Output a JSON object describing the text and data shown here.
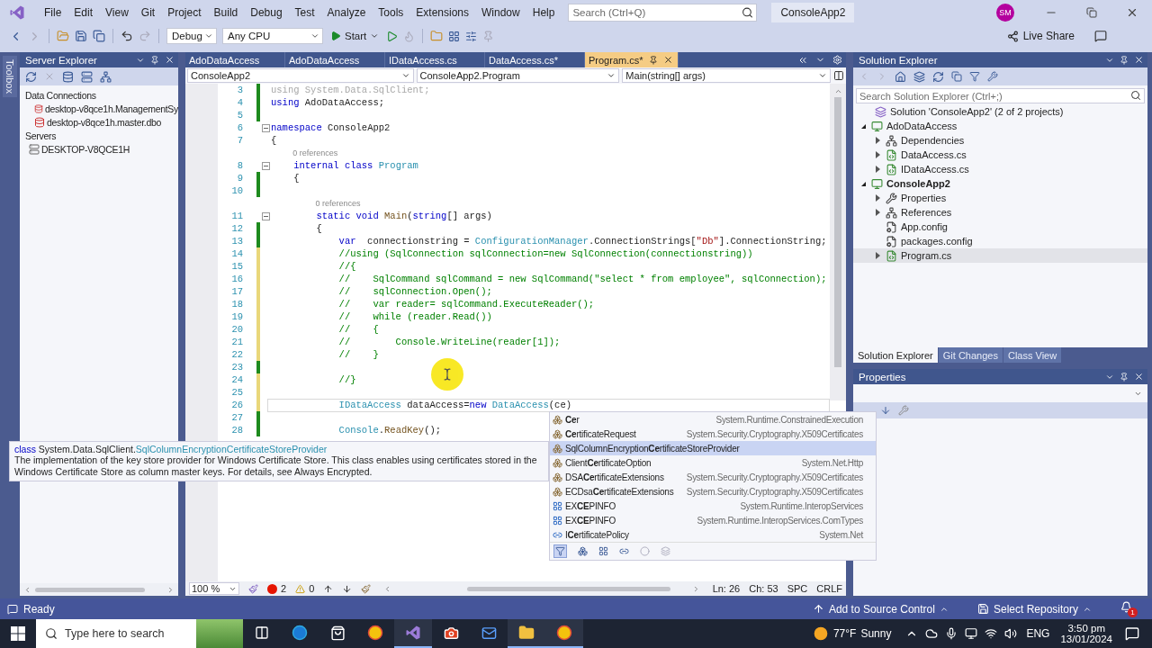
{
  "title_bar": {
    "menu": [
      "File",
      "Edit",
      "View",
      "Git",
      "Project",
      "Build",
      "Debug",
      "Test",
      "Analyze",
      "Tools",
      "Extensions",
      "Window",
      "Help"
    ],
    "search": {
      "placeholder": "Search (Ctrl+Q)"
    },
    "solution_name": "ConsoleApp2",
    "avatar": "SM"
  },
  "toolbar": {
    "configuration": "Debug",
    "platform": "Any CPU",
    "start": "Start",
    "live_share": "Live Share"
  },
  "toolbox_tab": "Toolbox",
  "server_explorer": {
    "title": "Server Explorer",
    "tree": [
      {
        "label": "Data Connections",
        "children": [
          {
            "label": "desktop-v8qce1h.ManagementSy",
            "kind": "connection"
          },
          {
            "label": "desktop-v8qce1h.master.dbo",
            "kind": "connection"
          }
        ]
      },
      {
        "label": "Servers",
        "children": [
          {
            "label": "DESKTOP-V8QCE1H",
            "kind": "server"
          }
        ]
      }
    ]
  },
  "editor": {
    "tabs": [
      {
        "label": "AdoDataAccess",
        "selected": false
      },
      {
        "label": "AdoDataAccess",
        "selected": false
      },
      {
        "label": "IDataAccess.cs",
        "selected": false
      },
      {
        "label": "DataAccess.cs*",
        "selected": false
      },
      {
        "label": "Program.cs*",
        "selected": true
      }
    ],
    "navigation": [
      "ConsoleApp2",
      "ConsoleApp2.Program",
      "Main(string[] args)"
    ],
    "lines": [
      {
        "kind": "code",
        "number": "3",
        "change_bar": {
          "saved": true
        },
        "fold": false,
        "current": false,
        "tokens": [
          {
            "kind": "faded",
            "text": "using System.Data.SqlClient;"
          }
        ]
      },
      {
        "kind": "code",
        "number": "4",
        "change_bar": {
          "saved": true
        },
        "fold": false,
        "current": false,
        "tokens": [
          {
            "kind": "keyword",
            "text": "using"
          },
          {
            "kind": "plain",
            "text": " AdoDataAccess;"
          }
        ]
      },
      {
        "kind": "code",
        "number": "5",
        "change_bar": {
          "saved": true
        },
        "fold": false,
        "current": false
      },
      {
        "kind": "code",
        "number": "6",
        "fold": true,
        "current": false,
        "tokens": [
          {
            "kind": "keyword",
            "text": "namespace"
          },
          {
            "kind": "plain",
            "text": " ConsoleApp2"
          }
        ]
      },
      {
        "kind": "code",
        "number": "7",
        "fold": false,
        "current": false,
        "tokens": [
          {
            "kind": "plain",
            "text": "{"
          }
        ]
      },
      {
        "kind": "codelens",
        "text": "0 references"
      },
      {
        "kind": "code",
        "number": "8",
        "fold": true,
        "current": false,
        "tokens": [
          {
            "kind": "keyword",
            "text": "    internal class"
          },
          {
            "kind": "type",
            "text": " Program"
          }
        ]
      },
      {
        "kind": "code",
        "number": "9",
        "change_bar": {
          "saved": true
        },
        "fold": false,
        "current": false,
        "tokens": [
          {
            "kind": "plain",
            "text": "    {"
          }
        ]
      },
      {
        "kind": "code",
        "number": "10",
        "change_bar": {
          "saved": true
        },
        "fold": false,
        "current": false
      },
      {
        "kind": "codelens",
        "text": "0 references"
      },
      {
        "kind": "code",
        "number": "11",
        "fold": true,
        "current": false,
        "tokens": [
          {
            "kind": "keyword",
            "text": "        static void"
          },
          {
            "kind": "method",
            "text": " Main"
          },
          {
            "kind": "plain",
            "text": "("
          },
          {
            "kind": "keyword",
            "text": "string"
          },
          {
            "kind": "plain",
            "text": "[] args)"
          }
        ]
      },
      {
        "kind": "code",
        "number": "12",
        "change_bar": {
          "saved": true
        },
        "fold": false,
        "current": false,
        "tokens": [
          {
            "kind": "plain",
            "text": "        {"
          }
        ]
      },
      {
        "kind": "code",
        "number": "13",
        "change_bar": {
          "saved": true
        },
        "fold": false,
        "current": false,
        "tokens": [
          {
            "kind": "keyword",
            "text": "            var"
          },
          {
            "kind": "plain",
            "text": "  connectionstring ="
          },
          {
            "kind": "type",
            "text": " ConfigurationManager"
          },
          {
            "kind": "plain",
            "text": ".ConnectionStrings["
          },
          {
            "kind": "string",
            "text": "\"Db\""
          },
          {
            "kind": "plain",
            "text": "].ConnectionString;"
          }
        ]
      },
      {
        "kind": "code",
        "number": "14",
        "change_bar": {
          "saved": false
        },
        "fold": false,
        "current": false,
        "tokens": [
          {
            "kind": "comment",
            "text": "            //using (SqlConnection sqlConnection=new SqlConnection(connectionstring))"
          }
        ]
      },
      {
        "kind": "code",
        "number": "15",
        "change_bar": {
          "saved": false
        },
        "fold": false,
        "current": false,
        "tokens": [
          {
            "kind": "comment",
            "text": "            //{"
          }
        ]
      },
      {
        "kind": "code",
        "number": "16",
        "change_bar": {
          "saved": false
        },
        "fold": false,
        "current": false,
        "tokens": [
          {
            "kind": "comment",
            "text": "            //    SqlCommand sqlCommand = new SqlCommand(\"select * from employee\", sqlConnection);"
          }
        ]
      },
      {
        "kind": "code",
        "number": "17",
        "change_bar": {
          "saved": false
        },
        "fold": false,
        "current": false,
        "tokens": [
          {
            "kind": "comment",
            "text": "            //    sqlConnection.Open();"
          }
        ]
      },
      {
        "kind": "code",
        "number": "18",
        "change_bar": {
          "saved": false
        },
        "fold": false,
        "current": false,
        "tokens": [
          {
            "kind": "comment",
            "text": "            //    var reader= sqlCommand.ExecuteReader();"
          }
        ]
      },
      {
        "kind": "code",
        "number": "19",
        "change_bar": {
          "saved": false
        },
        "fold": false,
        "current": false,
        "tokens": [
          {
            "kind": "comment",
            "text": "            //    while (reader.Read())"
          }
        ]
      },
      {
        "kind": "code",
        "number": "20",
        "change_bar": {
          "saved": false
        },
        "fold": false,
        "current": false,
        "tokens": [
          {
            "kind": "comment",
            "text": "            //    {"
          }
        ]
      },
      {
        "kind": "code",
        "number": "21",
        "change_bar": {
          "saved": false
        },
        "fold": false,
        "current": false,
        "tokens": [
          {
            "kind": "comment",
            "text": "            //        Console.WriteLine(reader[1]);"
          }
        ]
      },
      {
        "kind": "code",
        "number": "22",
        "change_bar": {
          "saved": false
        },
        "fold": false,
        "current": false,
        "tokens": [
          {
            "kind": "comment",
            "text": "            //    }"
          }
        ]
      },
      {
        "kind": "code",
        "number": "23",
        "change_bar": {
          "saved": true
        },
        "fold": false,
        "current": false
      },
      {
        "kind": "code",
        "number": "24",
        "change_bar": {
          "saved": false
        },
        "fold": false,
        "current": false,
        "tokens": [
          {
            "kind": "comment",
            "text": "            //}"
          }
        ]
      },
      {
        "kind": "code",
        "number": "25",
        "change_bar": {
          "saved": false
        },
        "fold": false,
        "current": false
      },
      {
        "kind": "code",
        "number": "26",
        "change_bar": {
          "saved": false
        },
        "fold": false,
        "current": true,
        "tokens": [
          {
            "kind": "type",
            "text": "            IDataAccess"
          },
          {
            "kind": "plain",
            "text": " dataAccess="
          },
          {
            "kind": "keyword",
            "text": "new"
          },
          {
            "kind": "type",
            "text": " DataAccess"
          },
          {
            "kind": "plain",
            "text": "(ce)"
          }
        ]
      },
      {
        "kind": "code",
        "number": "27",
        "change_bar": {
          "saved": true
        },
        "fold": false,
        "current": false
      },
      {
        "kind": "code",
        "number": "28",
        "change_bar": {
          "saved": true
        },
        "fold": false,
        "current": false,
        "tokens": [
          {
            "kind": "type",
            "text": "            Console"
          },
          {
            "kind": "plain",
            "text": "."
          },
          {
            "kind": "method",
            "text": "ReadKey"
          },
          {
            "kind": "plain",
            "text": "();"
          }
        ]
      }
    ],
    "status": {
      "zoom": "100 %",
      "errors": "2",
      "warnings": "0",
      "line": "Ln: 26",
      "column": "Ch: 53",
      "whitespace": "SPC",
      "line_ending": "CRLF"
    }
  },
  "completion": {
    "items": [
      {
        "name": "**Ce**r",
        "namespace": "System.Runtime.ConstrainedExecution",
        "kind": "class",
        "selected": false
      },
      {
        "name": "**Ce**rtificateRequest",
        "namespace": "System.Security.Cryptography.X509Certificates",
        "kind": "class",
        "selected": false
      },
      {
        "name": "SqlColumnEncryption**Ce**rtificateStoreProvider",
        "kind": "class",
        "selected": true
      },
      {
        "name": "Client**Ce**rtificateOption",
        "namespace": "System.Net.Http",
        "kind": "class",
        "selected": false
      },
      {
        "name": "DSA**Ce**rtificateExtensions",
        "namespace": "System.Security.Cryptography.X509Certificates",
        "kind": "class",
        "selected": false
      },
      {
        "name": "ECDsa**Ce**rtificateExtensions",
        "namespace": "System.Security.Cryptography.X509Certificates",
        "kind": "class",
        "selected": false
      },
      {
        "name": "EX**CE**PINFO",
        "namespace": "System.Runtime.InteropServices",
        "kind": "struct",
        "selected": false
      },
      {
        "name": "EX**CE**PINFO",
        "namespace": "System.Runtime.InteropServices.ComTypes",
        "kind": "struct",
        "selected": false
      },
      {
        "name": "I**Ce**rtificatePolicy",
        "namespace": "System.Net",
        "kind": "interface",
        "selected": false
      }
    ]
  },
  "tooltip": {
    "keyword": "class",
    "namespace": "System.Data.SqlClient.",
    "type": "SqlColumnEncryptionCertificateStoreProvider",
    "description": "The implementation of the key store provider for Windows Certificate Store. This class enables using certificates stored in the Windows Certificate Store as column master keys. For details, see Always Encrypted."
  },
  "solution_explorer": {
    "title": "Solution Explorer",
    "search": {
      "placeholder": "Search Solution Explorer (Ctrl+;)"
    },
    "tree": [
      {
        "label": "Solution 'ConsoleApp2' (2 of 2 projects)",
        "kind": "solution",
        "expandable": false,
        "startup": false,
        "selected": false,
        "children": [
          {
            "label": "AdoDataAccess",
            "kind": "project",
            "expandable": true,
            "expanded": true,
            "startup": false,
            "selected": false,
            "children": [
              {
                "label": "Dependencies",
                "kind": "dependencies",
                "expandable": true,
                "expanded": false,
                "startup": false,
                "selected": false
              },
              {
                "label": "DataAccess.cs",
                "kind": "csharp",
                "expandable": true,
                "expanded": false,
                "startup": false,
                "selected": false
              },
              {
                "label": "IDataAccess.cs",
                "kind": "csharp",
                "expandable": true,
                "expanded": false,
                "startup": false,
                "selected": false
              }
            ]
          },
          {
            "label": "ConsoleApp2",
            "kind": "project",
            "expandable": true,
            "expanded": true,
            "startup": true,
            "selected": false,
            "children": [
              {
                "label": "Properties",
                "kind": "properties",
                "expandable": true,
                "expanded": false,
                "startup": false,
                "selected": false
              },
              {
                "label": "References",
                "kind": "dependencies",
                "expandable": true,
                "expanded": false,
                "startup": false,
                "selected": false
              },
              {
                "label": "App.config",
                "kind": "config",
                "expandable": false,
                "startup": false,
                "selected": false
              },
              {
                "label": "packages.config",
                "kind": "config",
                "expandable": false,
                "startup": false,
                "selected": false
              },
              {
                "label": "Program.cs",
                "kind": "csharp",
                "expandable": true,
                "expanded": false,
                "startup": false,
                "selected": true
              }
            ]
          }
        ]
      }
    ],
    "tabs": [
      {
        "label": "Solution Explorer",
        "selected": true
      },
      {
        "label": "Git Changes",
        "selected": false
      },
      {
        "label": "Class View",
        "selected": false
      }
    ]
  },
  "properties": {
    "title": "Properties"
  },
  "status_bar": {
    "message": "Ready",
    "source_control": "Add to Source Control",
    "repository": "Select Repository",
    "notifications": "1"
  },
  "taskbar": {
    "search": {
      "placeholder": "Type here to search"
    },
    "apps": [
      {
        "kind": "task-view",
        "active": false
      },
      {
        "kind": "edge",
        "active": false
      },
      {
        "kind": "store",
        "active": false
      },
      {
        "kind": "chrome",
        "active": false
      },
      {
        "kind": "visual-studio",
        "active": true
      },
      {
        "kind": "recorder",
        "active": false
      },
      {
        "kind": "mail",
        "active": false
      },
      {
        "kind": "explorer",
        "active": true
      },
      {
        "kind": "chrome",
        "active": true
      }
    ],
    "temperature": "77°F",
    "weather": "Sunny",
    "language": "ENG",
    "time": "3:50 pm",
    "date": "13/01/2024"
  }
}
